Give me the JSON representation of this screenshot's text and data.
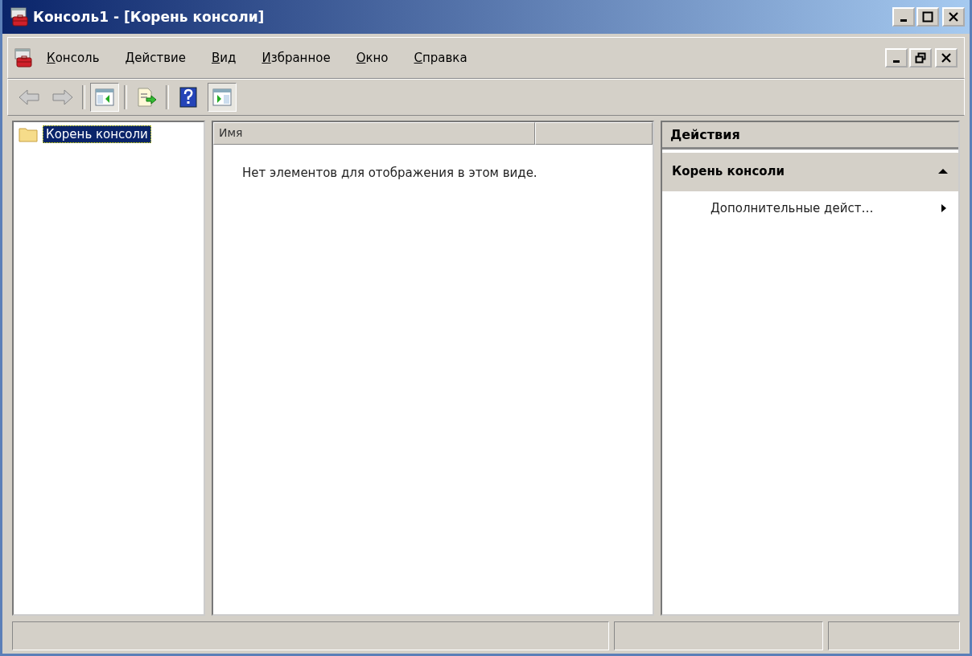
{
  "window": {
    "title": "Консоль1 - [Корень консоли]"
  },
  "menu": [
    {
      "label": "Консоль"
    },
    {
      "label": "Действие"
    },
    {
      "label": "Вид"
    },
    {
      "label": "Избранное"
    },
    {
      "label": "Окно"
    },
    {
      "label": "Справка"
    }
  ],
  "toolbar": [
    {
      "kind": "back",
      "pressed": false
    },
    {
      "kind": "forward",
      "pressed": false
    },
    {
      "kind": "separator"
    },
    {
      "kind": "tree",
      "pressed": true
    },
    {
      "kind": "separator"
    },
    {
      "kind": "export",
      "pressed": false
    },
    {
      "kind": "separator"
    },
    {
      "kind": "help",
      "pressed": false
    },
    {
      "kind": "actions",
      "pressed": true
    }
  ],
  "tree": {
    "items": [
      {
        "label": "Корень консоли",
        "selected": true
      }
    ]
  },
  "list": {
    "columns": [
      "Имя"
    ],
    "empty_text": "Нет элементов для отображения в этом виде."
  },
  "actions": {
    "title": "Действия",
    "sections": [
      {
        "title": "Корень консоли",
        "expanded": true,
        "items": [
          {
            "label": "Дополнительные дейст…",
            "submenu": true
          }
        ]
      }
    ]
  }
}
